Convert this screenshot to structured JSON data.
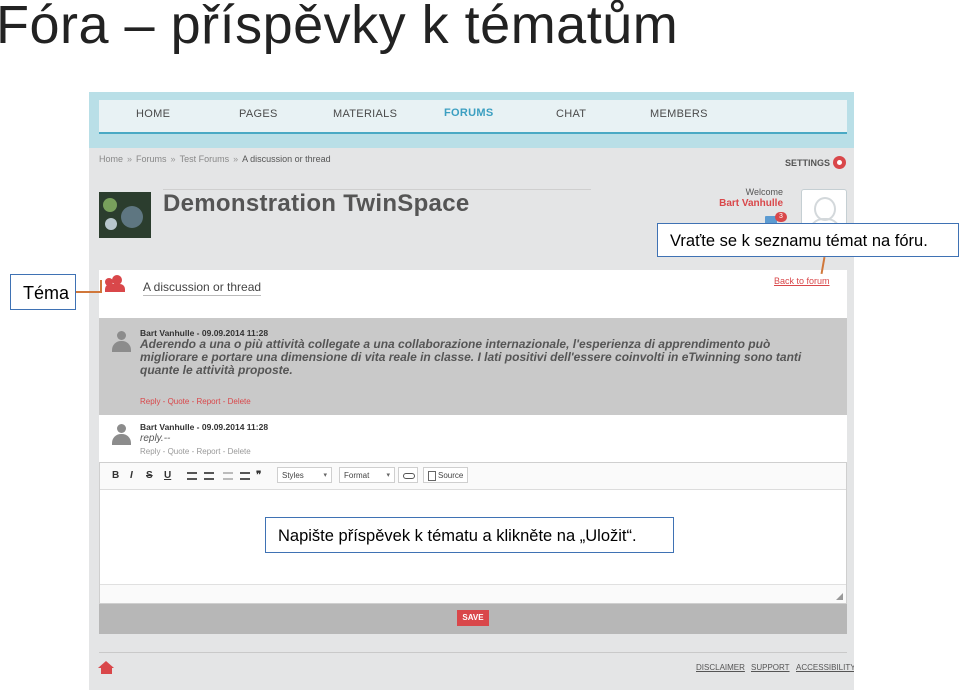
{
  "slide": {
    "title": "Fóra – příspěvky k tématům"
  },
  "nav": {
    "items": [
      "HOME",
      "PAGES",
      "MATERIALS",
      "FORUMS",
      "CHAT",
      "MEMBERS"
    ],
    "active": "FORUMS",
    "accent_color": "#49a9c4"
  },
  "breadcrumb": {
    "items": [
      "Home",
      "Forums",
      "Test Forums"
    ],
    "current": "A discussion or thread",
    "separator": "»"
  },
  "settings": {
    "label": "SETTINGS",
    "icon": "gear-icon"
  },
  "space": {
    "title": "Demonstration TwinSpace"
  },
  "user": {
    "welcome": "Welcome",
    "name": "Bart Vanhulle",
    "unread_count": "3",
    "avatar_icon": "user-silhouette-icon",
    "mail_icon": "envelope-icon"
  },
  "topic": {
    "title": "A discussion or thread",
    "back_link": "Back to forum",
    "icon": "group-icon"
  },
  "posts": [
    {
      "author_date": "Bart Vanhulle - 09.09.2014 11:28",
      "body": "Aderendo a una o più attività collegate a una collaborazione internazionale, l'esperienza di apprendimento può migliorare e portare una dimensione di vita reale in classe. I lati positivi dell'essere coinvolti in eTwinning sono tanti quante le attività proposte.",
      "actions": [
        "Reply",
        "Quote",
        "Report",
        "Delete"
      ]
    },
    {
      "author_date": "Bart Vanhulle - 09.09.2014 11:28",
      "body": "reply.--",
      "actions": [
        "Reply",
        "Quote",
        "Report",
        "Delete"
      ]
    }
  ],
  "editor": {
    "bold": "B",
    "italic": "I",
    "strike": "S",
    "underline": "U",
    "quote_mark": "❞",
    "styles": "Styles",
    "format": "Format",
    "source": "Source",
    "dropdown_arrow": "▾"
  },
  "save_label": "SAVE",
  "footer": {
    "links": [
      "DISCLAIMER",
      "SUPPORT",
      "ACCESSIBILITY"
    ],
    "home_icon": "home-icon"
  },
  "brand_color": "#d9474a",
  "annotations": {
    "topic": "Téma",
    "back": "Vraťte se k seznamu témat na fóru.",
    "write": "Napište příspěvek k tématu a klikněte na „Uložit“.",
    "connector_color": "#d0773a",
    "border_color": "#3f72b4"
  }
}
